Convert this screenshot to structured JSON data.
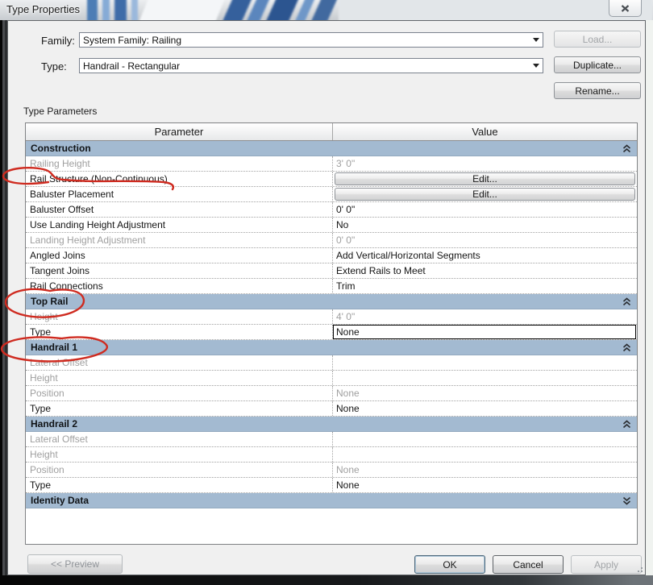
{
  "window": {
    "title": "Type Properties",
    "close_label": "close"
  },
  "header": {
    "family_label": "Family:",
    "family_value": "System Family: Railing",
    "load_label": "Load...",
    "type_label": "Type:",
    "type_value": "Handrail - Rectangular",
    "duplicate_label": "Duplicate...",
    "rename_label": "Rename..."
  },
  "table": {
    "caption": "Type Parameters",
    "columns": [
      "Parameter",
      "Value"
    ],
    "sections": [
      {
        "name": "Construction",
        "state": "expanded",
        "annotated": false,
        "rows": [
          {
            "param": "Railing Height",
            "value": "3' 0\"",
            "kind": "text",
            "param_disabled": true,
            "value_disabled": true
          },
          {
            "param": "Rail Structure (Non-Continuous)",
            "value": "Edit...",
            "kind": "button",
            "annotated": true
          },
          {
            "param": "Baluster Placement",
            "value": "Edit...",
            "kind": "button"
          },
          {
            "param": "Baluster Offset",
            "value": "0' 0\"",
            "kind": "text"
          },
          {
            "param": "Use Landing Height Adjustment",
            "value": "No",
            "kind": "text"
          },
          {
            "param": "Landing Height Adjustment",
            "value": "0' 0\"",
            "kind": "text",
            "param_disabled": true,
            "value_disabled": true
          },
          {
            "param": "Angled Joins",
            "value": "Add Vertical/Horizontal Segments",
            "kind": "text"
          },
          {
            "param": "Tangent Joins",
            "value": "Extend Rails to Meet",
            "kind": "text"
          },
          {
            "param": "Rail Connections",
            "value": "Trim",
            "kind": "text"
          }
        ]
      },
      {
        "name": "Top Rail",
        "state": "expanded",
        "annotated": true,
        "rows": [
          {
            "param": "Height",
            "value": "4' 0\"",
            "kind": "text",
            "param_disabled": true,
            "value_disabled": true
          },
          {
            "param": "Type",
            "value": "None",
            "kind": "text",
            "focused": true
          }
        ]
      },
      {
        "name": "Handrail 1",
        "state": "expanded",
        "annotated": true,
        "rows": [
          {
            "param": "Lateral Offset",
            "value": "",
            "kind": "text",
            "param_disabled": true,
            "value_disabled": true,
            "annotated": true
          },
          {
            "param": "Height",
            "value": "",
            "kind": "text",
            "param_disabled": true,
            "value_disabled": true
          },
          {
            "param": "Position",
            "value": "None",
            "kind": "text",
            "param_disabled": true,
            "value_disabled": true
          },
          {
            "param": "Type",
            "value": "None",
            "kind": "text"
          }
        ]
      },
      {
        "name": "Handrail 2",
        "state": "expanded",
        "annotated": false,
        "rows": [
          {
            "param": "Lateral Offset",
            "value": "",
            "kind": "text",
            "param_disabled": true,
            "value_disabled": true
          },
          {
            "param": "Height",
            "value": "",
            "kind": "text",
            "param_disabled": true,
            "value_disabled": true
          },
          {
            "param": "Position",
            "value": "None",
            "kind": "text",
            "param_disabled": true,
            "value_disabled": true
          },
          {
            "param": "Type",
            "value": "None",
            "kind": "text"
          }
        ]
      },
      {
        "name": "Identity Data",
        "state": "collapsed",
        "annotated": false,
        "rows": []
      }
    ]
  },
  "footer": {
    "preview_label": "<< Preview",
    "ok_label": "OK",
    "cancel_label": "Cancel",
    "apply_label": "Apply"
  },
  "annotations": {
    "color": "#cf2b20",
    "items": [
      "circle-strike on Rail Structure (Non-Continuous)",
      "circle on Top Rail section header",
      "circle on Handrail 1 header striking Lateral Offset"
    ]
  },
  "colors": {
    "section_header": "#a3bad1",
    "dialog_bg": "#f0f0f0",
    "disabled_text": "#9f9f9f"
  }
}
